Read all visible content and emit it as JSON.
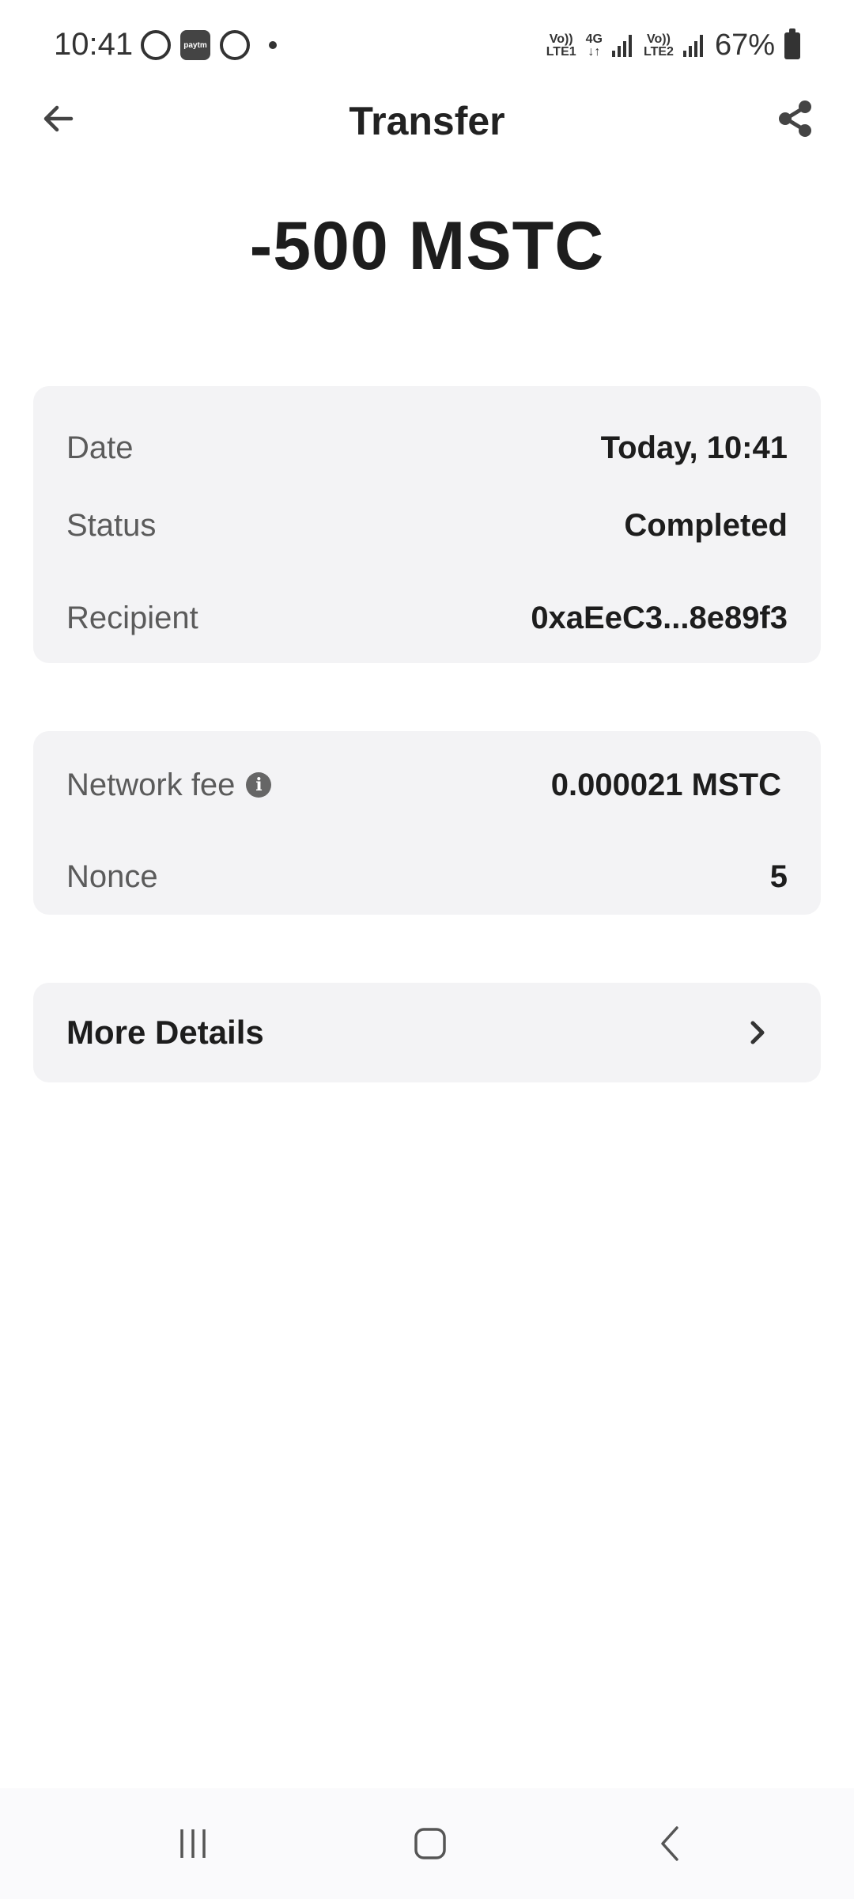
{
  "status_bar": {
    "time": "10:41",
    "net1_top": "Vo))",
    "net1_bottom": "LTE1",
    "net_mid_top": "4G",
    "net_mid_bottom": "↓↑",
    "net2_top": "Vo))",
    "net2_bottom": "LTE2",
    "battery": "67%",
    "app_icons": [
      "whatsapp-icon",
      "paytm-icon",
      "cred-icon"
    ]
  },
  "header": {
    "title": "Transfer",
    "back_icon": "arrow-left-icon",
    "share_icon": "share-icon"
  },
  "amount": "-500 MSTC",
  "details": [
    {
      "label": "Date",
      "value": "Today, 10:41"
    },
    {
      "label": "Status",
      "value": "Completed"
    },
    {
      "label": "Recipient",
      "value": "0xaEeC3...8e89f3"
    }
  ],
  "fees": [
    {
      "label": "Network fee",
      "value": "0.000021 MSTC",
      "icon": "info-icon"
    },
    {
      "label": "Nonce",
      "value": "5"
    }
  ],
  "more_details": {
    "label": "More Details",
    "icon": "chevron-right-icon"
  },
  "paytm_text": "paytm",
  "colors": {
    "card_bg": "#f3f3f5",
    "text": "#1d1d1d",
    "label": "#5b5b5b"
  }
}
